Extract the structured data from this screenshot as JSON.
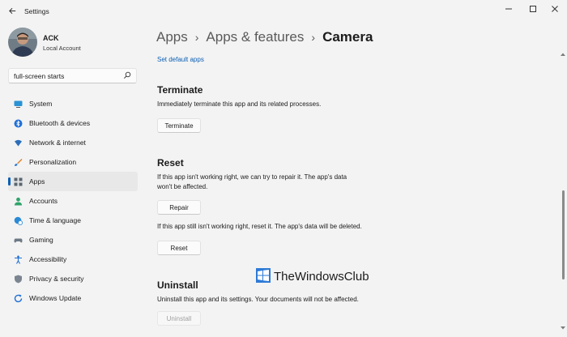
{
  "window": {
    "title": "Settings"
  },
  "profile": {
    "name": "ACK",
    "account_type": "Local Account"
  },
  "search": {
    "value": "full-screen starts"
  },
  "sidebar": {
    "items": [
      {
        "label": "System",
        "icon": "monitor-icon",
        "selected": false
      },
      {
        "label": "Bluetooth & devices",
        "icon": "bluetooth-icon",
        "selected": false
      },
      {
        "label": "Network & internet",
        "icon": "wifi-icon",
        "selected": false
      },
      {
        "label": "Personalization",
        "icon": "brush-icon",
        "selected": false
      },
      {
        "label": "Apps",
        "icon": "apps-icon",
        "selected": true
      },
      {
        "label": "Accounts",
        "icon": "person-icon",
        "selected": false
      },
      {
        "label": "Time & language",
        "icon": "globe-clock-icon",
        "selected": false
      },
      {
        "label": "Gaming",
        "icon": "gamepad-icon",
        "selected": false
      },
      {
        "label": "Accessibility",
        "icon": "accessibility-icon",
        "selected": false
      },
      {
        "label": "Privacy & security",
        "icon": "shield-icon",
        "selected": false
      },
      {
        "label": "Windows Update",
        "icon": "update-icon",
        "selected": false
      }
    ]
  },
  "breadcrumb": {
    "root": "Apps",
    "parent": "Apps & features",
    "current": "Camera",
    "separator": "›"
  },
  "main": {
    "set_default_link": "Set default apps",
    "terminate": {
      "title": "Terminate",
      "description": "Immediately terminate this app and its related processes.",
      "button": "Terminate"
    },
    "reset": {
      "title": "Reset",
      "repair_description_line1": "If this app isn't working right, we can try to repair it. The app's data",
      "repair_description_line2": "won't be affected.",
      "repair_button": "Repair",
      "reset_description": "If this app still isn't working right, reset it. The app's data will be deleted.",
      "reset_button": "Reset"
    },
    "uninstall": {
      "title": "Uninstall",
      "description": "Uninstall this app and its settings. Your documents will not be affected.",
      "button": "Uninstall",
      "button_disabled": true
    }
  },
  "watermark": {
    "text": "TheWindowsClub"
  },
  "colors": {
    "accent": "#0a5fb4",
    "background": "#f3f3f3",
    "selected_nav": "#e8e8e8"
  }
}
